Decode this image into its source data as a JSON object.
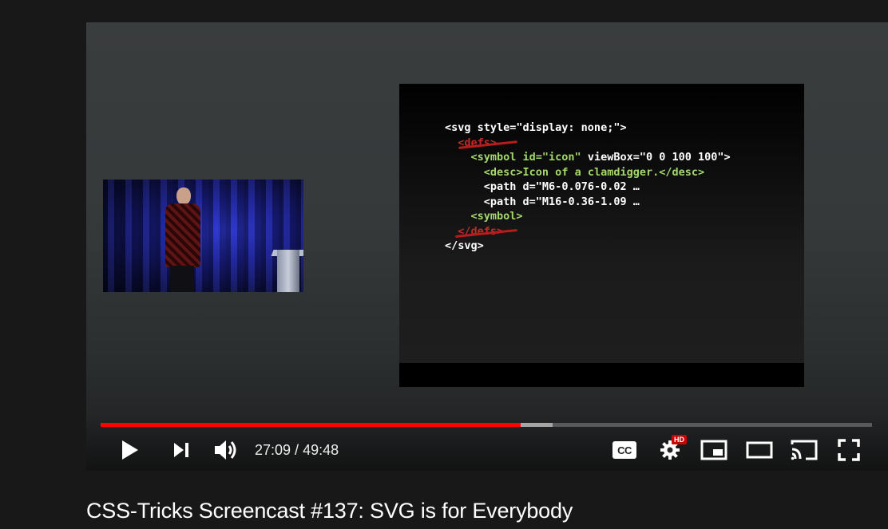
{
  "player": {
    "slide": {
      "code_lines": [
        {
          "indent": "",
          "parts": [
            {
              "text": "<svg style=\"display: none;\">",
              "color": "white"
            }
          ]
        },
        {
          "indent": "  ",
          "parts": [
            {
              "text": "<defs>",
              "color": "red"
            }
          ]
        },
        {
          "indent": "    ",
          "parts": [
            {
              "text": "<symbol id=\"icon\" ",
              "color": "green"
            },
            {
              "text": "viewBox=\"0 0 100 100\">",
              "color": "white"
            }
          ]
        },
        {
          "indent": "      ",
          "parts": [
            {
              "text": "<desc>Icon of a clamdigger.</desc>",
              "color": "green"
            }
          ]
        },
        {
          "indent": "      ",
          "parts": [
            {
              "text": "<path d=\"M6-0.076-0.02 …",
              "color": "white"
            }
          ]
        },
        {
          "indent": "      ",
          "parts": [
            {
              "text": "<path d=\"M16-0.36-1.09 …",
              "color": "white"
            }
          ]
        },
        {
          "indent": "    ",
          "parts": [
            {
              "text": "<symbol>",
              "color": "green"
            }
          ]
        },
        {
          "indent": "  ",
          "parts": [
            {
              "text": "</defs>",
              "color": "red"
            }
          ]
        },
        {
          "indent": "",
          "parts": [
            {
              "text": "</svg>",
              "color": "white"
            }
          ]
        }
      ]
    },
    "progress": {
      "played_fraction": 0.5445,
      "loaded_fraction": 0.586
    },
    "time": {
      "current": "27:09",
      "separator": " / ",
      "duration": "49:48"
    },
    "controls": {
      "play_icon": "play-icon",
      "next_icon": "next-icon",
      "volume_icon": "volume-icon",
      "cc_label": "CC",
      "hd_badge": "HD",
      "settings_icon": "gear-icon",
      "miniplayer_icon": "miniplayer-icon",
      "theater_icon": "theater-icon",
      "cast_icon": "cast-icon",
      "fullscreen_icon": "fullscreen-icon"
    },
    "colors": {
      "progress_played": "#ff0000",
      "hd_badge": "#cc0000",
      "code_green": "#a4d86c",
      "code_strike": "#b71c1c"
    }
  },
  "video": {
    "title": "CSS-Tricks Screencast #137: SVG is for Everybody"
  }
}
